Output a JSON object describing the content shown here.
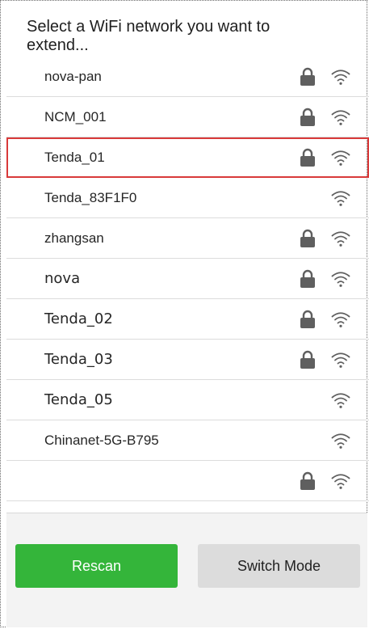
{
  "header": {
    "title": "Select a WiFi network you want to extend..."
  },
  "networks": [
    {
      "ssid": "nova-pan",
      "locked": true,
      "style": "ui"
    },
    {
      "ssid": "NCM_001",
      "locked": true,
      "style": "ui"
    },
    {
      "ssid": "Tenda_01",
      "locked": true,
      "style": "ui",
      "selected": true
    },
    {
      "ssid": "Tenda_83F1F0",
      "locked": false,
      "style": "ui"
    },
    {
      "ssid": "zhangsan",
      "locked": true,
      "style": "ui"
    },
    {
      "ssid": "nova",
      "locked": true,
      "style": "plain"
    },
    {
      "ssid": "Tenda_02",
      "locked": true,
      "style": "plain"
    },
    {
      "ssid": "Tenda_03",
      "locked": true,
      "style": "plain"
    },
    {
      "ssid": "Tenda_05",
      "locked": false,
      "style": "plain"
    },
    {
      "ssid": "Chinanet-5G-B795",
      "locked": false,
      "style": "ui"
    },
    {
      "ssid": "",
      "locked": true,
      "style": "ui"
    }
  ],
  "footer": {
    "rescan_label": "Rescan",
    "switch_mode_label": "Switch Mode"
  },
  "colors": {
    "accent": "#34b53a",
    "selected_border": "#d93a3a",
    "icon": "#5f5f5f"
  },
  "icons": {
    "lock": "lock-icon",
    "wifi": "wifi-signal-icon"
  }
}
